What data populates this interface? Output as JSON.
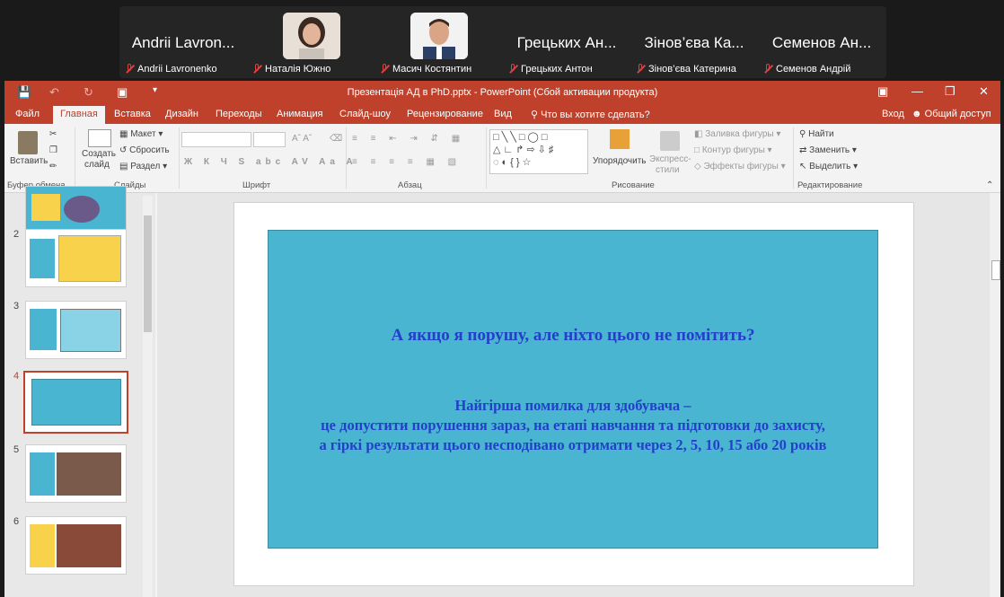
{
  "participants": [
    {
      "display": "Andrii Lavron...",
      "label": "Andrii Lavronenko",
      "has_video": false
    },
    {
      "display": "",
      "label": "Наталія Южно",
      "has_video": true
    },
    {
      "display": "",
      "label": "Масич Костянтин",
      "has_video": true
    },
    {
      "display": "Грецьких Ан...",
      "label": "Грецьких Антон",
      "has_video": false
    },
    {
      "display": "Зінов’єва Ка...",
      "label": "Зінов’єва Катерина",
      "has_video": false
    },
    {
      "display": "Семенов Ан...",
      "label": "Семенов Андрій",
      "has_video": false
    }
  ],
  "window": {
    "title": "Презентація АД в PhD.pptx - PowerPoint (Сбой активации продукта)",
    "accent": "#c0412b"
  },
  "tabs": [
    "Файл",
    "Главная",
    "Вставка",
    "Дизайн",
    "Переходы",
    "Анимация",
    "Слайд-шоу",
    "Рецензирование",
    "Вид"
  ],
  "active_tab": "Главная",
  "tell_me": "Что вы хотите сделать?",
  "signin": "Вход",
  "share": "Общий доступ",
  "ribbon": {
    "paste": "Вставить",
    "new_slide_1": "Создать",
    "new_slide_2": "слайд",
    "layout": "Макет",
    "reset": "Сбросить",
    "section": "Раздел",
    "arrange": "Упорядочить",
    "quick_styles_1": "Экспресс-",
    "quick_styles_2": "стили",
    "shape_fill": "Заливка фигуры",
    "shape_outline": "Контур фигуры",
    "shape_effects": "Эффекты фигуры",
    "find": "Найти",
    "replace": "Заменить",
    "select": "Выделить",
    "groups": {
      "clipboard": "Буфер обмена",
      "slides": "Слайды",
      "font": "Шрифт",
      "paragraph": "Абзац",
      "drawing": "Рисование",
      "editing": "Редактирование"
    }
  },
  "thumbnails": [
    {
      "number": ""
    },
    {
      "number": "2"
    },
    {
      "number": "3"
    },
    {
      "number": "4",
      "selected": true
    },
    {
      "number": "5"
    },
    {
      "number": "6"
    }
  ],
  "slide": {
    "background": "#4ab5d1",
    "text_color": "#2240c8",
    "question": "А якщо я порушу, але ніхто цього не помітить?",
    "answer_line1": "Найгірша помилка для здобувача –",
    "answer_line2": "це допустити порушення зараз, на етапі навчання та підготовки до захисту,",
    "answer_line3": "а гіркі результати цього несподівано отримати через 2, 5, 10, 15 або 20 років"
  }
}
